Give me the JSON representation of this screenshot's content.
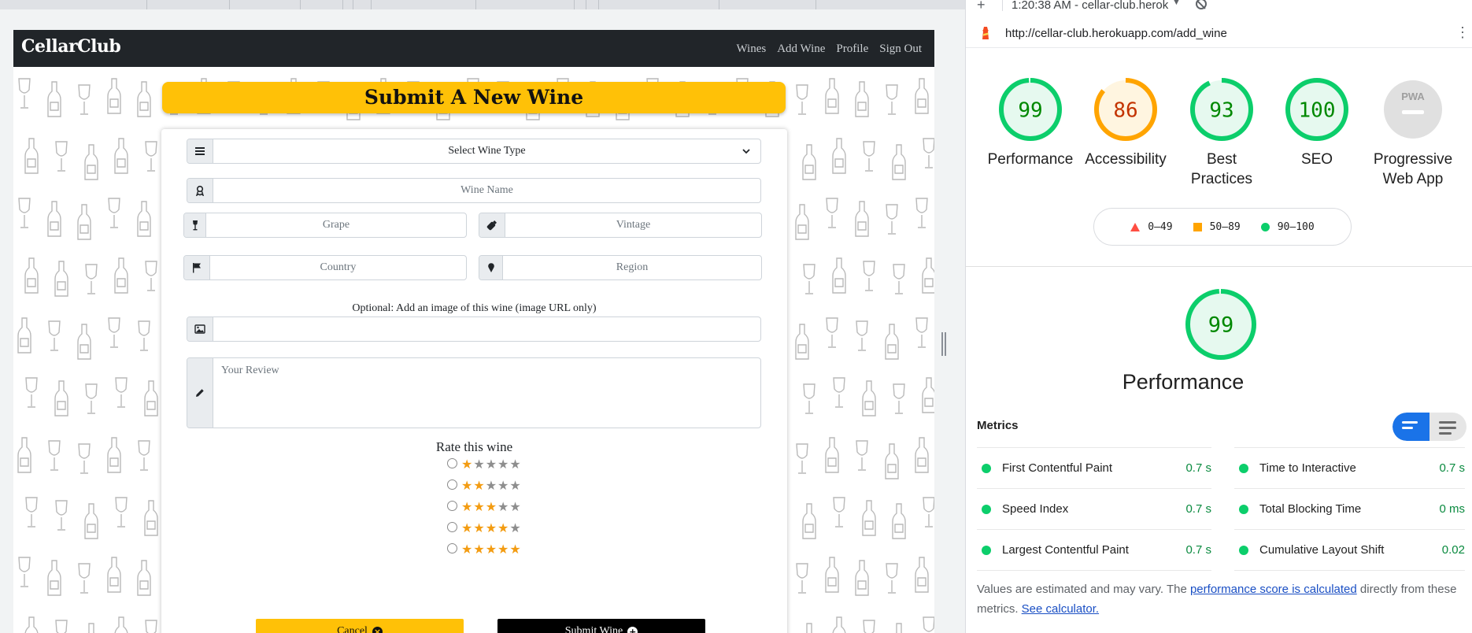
{
  "app": {
    "brand": "CellarClub",
    "nav": [
      "Wines",
      "Add Wine",
      "Profile",
      "Sign Out"
    ]
  },
  "form": {
    "title": "Submit A New Wine",
    "wine_type": "Select Wine Type",
    "wine_name_placeholder": "Wine Name",
    "grape_placeholder": "Grape",
    "vintage_placeholder": "Vintage",
    "country_placeholder": "Country",
    "region_placeholder": "Region",
    "image_label": "Optional: Add an image of this wine (image URL only)",
    "review_placeholder": "Your Review",
    "rate_title": "Rate this wine",
    "ratings": [
      1,
      2,
      3,
      4,
      5
    ],
    "rating_max": 5,
    "cancel_label": "Cancel",
    "submit_label": "Submit Wine",
    "accent_color": "#ffc107"
  },
  "lighthouse": {
    "run_label": "1:20:38 AM - cellar-club.herok",
    "url": "http://cellar-club.herokuapp.com/add_wine",
    "scores": [
      {
        "label": "Performance",
        "value": "99",
        "color": "#0cce6b",
        "fill": "#e6f9ef",
        "fraction": 0.99
      },
      {
        "label": "Accessibility",
        "value": "86",
        "color": "#ffa400",
        "fill": "#fff5e0",
        "fraction": 0.86
      },
      {
        "label": "Best Practices",
        "value": "93",
        "color": "#0cce6b",
        "fill": "#e6f9ef",
        "fraction": 0.93
      },
      {
        "label": "SEO",
        "value": "100",
        "color": "#0cce6b",
        "fill": "#e6f9ef",
        "fraction": 1.0
      },
      {
        "label": "Progressive Web App",
        "value": "PWA",
        "color": "#bdbdbd",
        "fill": "#e0e0e0",
        "fraction": 0
      }
    ],
    "legend": [
      "0–49",
      "50–89",
      "90–100"
    ],
    "main_score": "99",
    "main_label": "Performance",
    "metrics_title": "Metrics",
    "metrics": [
      {
        "name": "First Contentful Paint",
        "value": "0.7 s"
      },
      {
        "name": "Time to Interactive",
        "value": "0.7 s"
      },
      {
        "name": "Speed Index",
        "value": "0.7 s"
      },
      {
        "name": "Total Blocking Time",
        "value": "0 ms"
      },
      {
        "name": "Largest Contentful Paint",
        "value": "0.7 s"
      },
      {
        "name": "Cumulative Layout Shift",
        "value": "0.02"
      }
    ],
    "footer_text_1": "Values are estimated and may vary. The ",
    "footer_link_1": "performance score is calculated",
    "footer_text_2": " directly from these metrics. ",
    "footer_link_2": "See calculator."
  }
}
